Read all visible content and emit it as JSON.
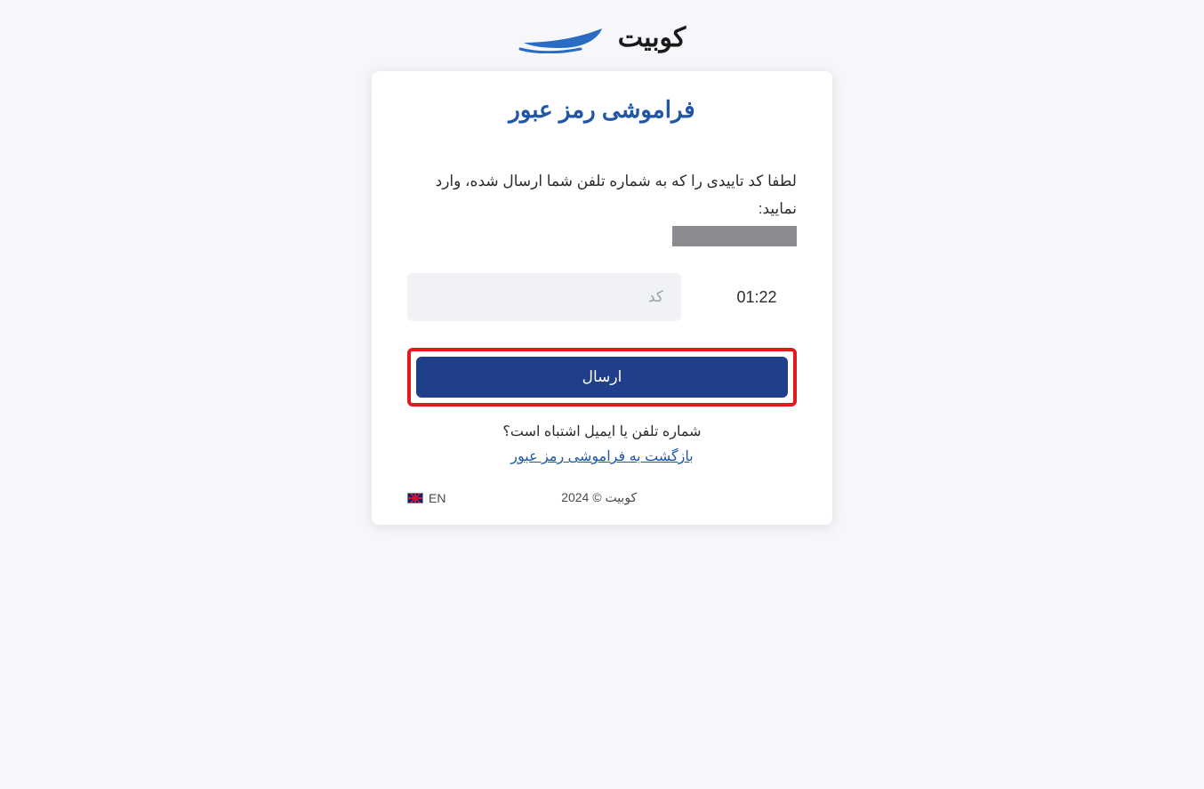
{
  "brand": {
    "name": "کوبیت"
  },
  "card": {
    "title": "فراموشی رمز عبور",
    "instruction": "لطفا کد تاییدی را که به شماره تلفن شما ارسال شده، وارد نمایید:",
    "timer": "01:22",
    "code_placeholder": "کد",
    "submit_label": "ارسال",
    "wrong_text": "شماره تلفن یا ایمیل اشتباه است؟",
    "back_link": "بازگشت به فراموشی رمز عبور"
  },
  "footer": {
    "lang_label": "EN",
    "copyright": "کوبیت © 2024"
  }
}
